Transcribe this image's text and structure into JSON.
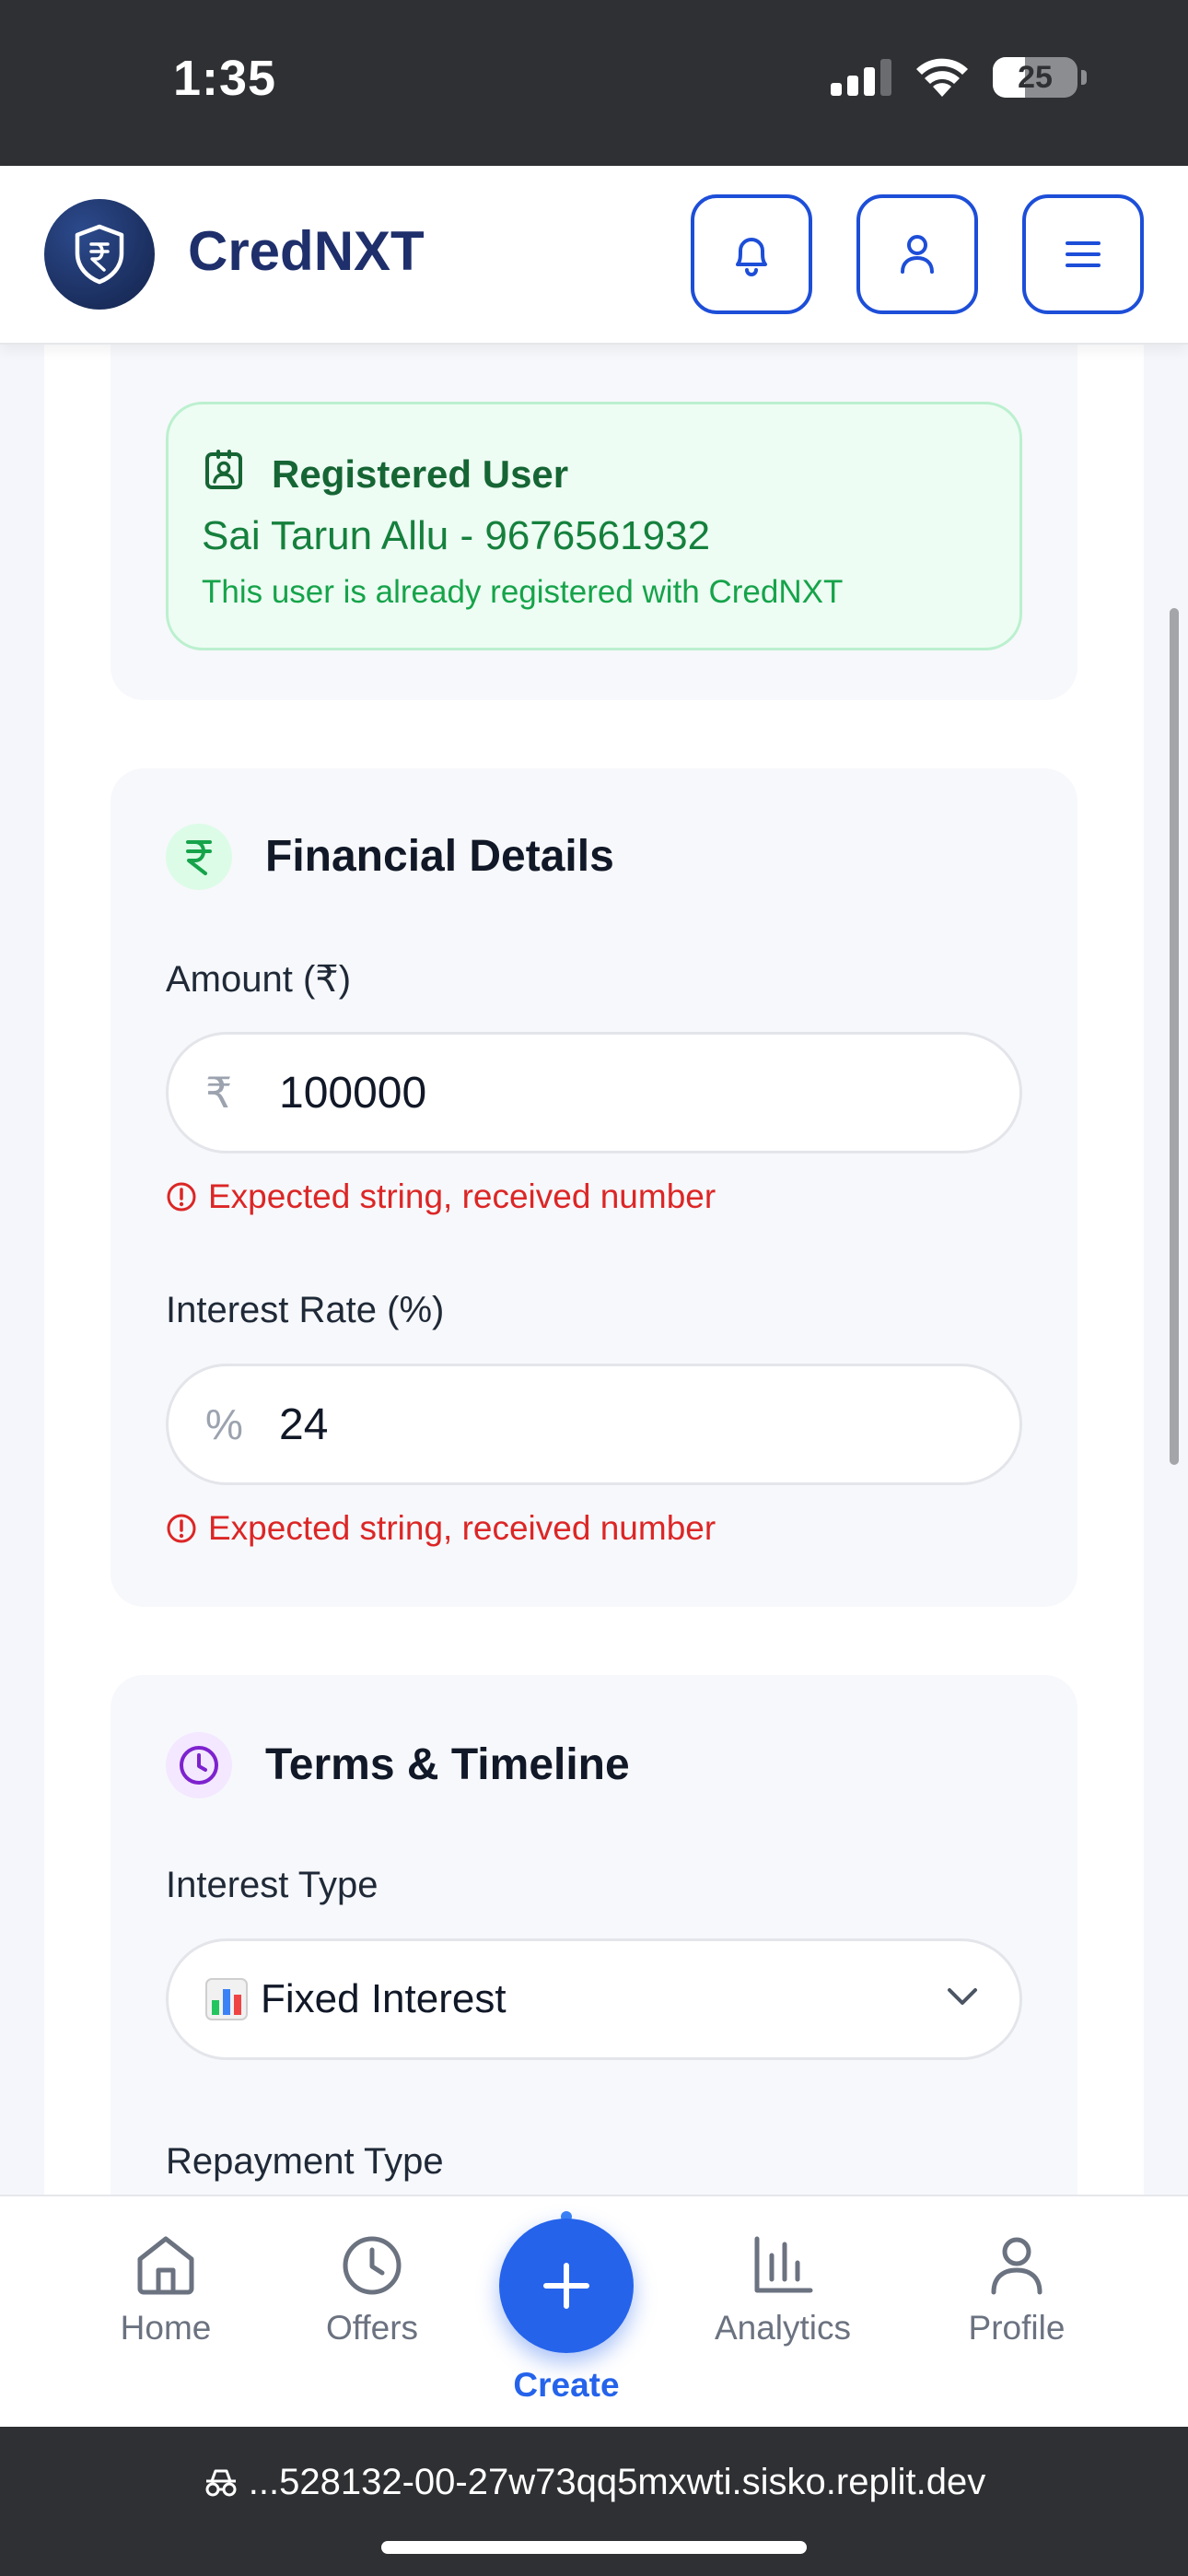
{
  "status": {
    "time": "1:35",
    "battery": "25"
  },
  "header": {
    "brand": "CredNXT"
  },
  "registered": {
    "title": "Registered User",
    "name": "Sai Tarun Allu - 9676561932",
    "note": "This user is already registered with CredNXT"
  },
  "financial": {
    "title": "Financial Details",
    "amount_label": "Amount (₹)",
    "amount_prefix": "₹",
    "amount_value": "100000",
    "amount_error": "Expected string, received number",
    "rate_label": "Interest Rate (%)",
    "rate_prefix": "%",
    "rate_value": "24",
    "rate_error": "Expected string, received number"
  },
  "terms": {
    "title": "Terms & Timeline",
    "interest_type_label": "Interest Type",
    "interest_type_value": "Fixed Interest",
    "repayment_type_label": "Repayment Type"
  },
  "nav": {
    "home": "Home",
    "offers": "Offers",
    "create": "Create",
    "analytics": "Analytics",
    "profile": "Profile"
  },
  "browser": {
    "url": "...528132-00-27w73qq5mxwti.sisko.replit.dev"
  },
  "colors": {
    "primary": "#2563eb",
    "brand": "#1e2f6b",
    "success": "#16a34a",
    "error": "#dc2626",
    "purple": "#7e22ce"
  },
  "icons": [
    "shield-rupee-icon",
    "bell-icon",
    "user-icon",
    "menu-icon",
    "id-badge-icon",
    "rupee-icon",
    "clock-icon",
    "chart-emoji-icon",
    "chevron-down-icon",
    "home-icon",
    "plus-icon",
    "analytics-icon",
    "incognito-icon"
  ]
}
